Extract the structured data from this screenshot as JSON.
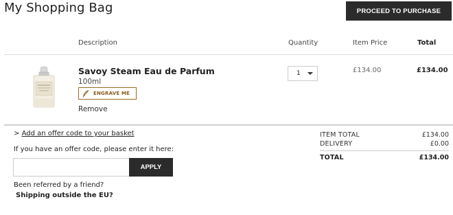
{
  "header": {
    "title": "My Shopping Bag",
    "proceed_label": "PROCEED TO PURCHASE"
  },
  "columns": {
    "description": "Description",
    "quantity": "Quantity",
    "item_price": "Item Price",
    "total": "Total"
  },
  "item": {
    "name": "Savoy Steam Eau de Parfum",
    "size": "100ml",
    "engrave_label": "ENGRAVE ME",
    "remove_label": "Remove",
    "quantity": "1",
    "item_price": "£134.00",
    "total": "£134.00"
  },
  "offer": {
    "prefix": ">",
    "link_label": "Add an offer code to your basket",
    "prompt": "If you have an offer code, please enter it here:",
    "input_value": "",
    "apply_label": "APPLY"
  },
  "footer_links": {
    "referred": "Been referred by a friend?",
    "shipping": "Shipping outside the EU?"
  },
  "summary": {
    "item_total_label": "ITEM TOTAL",
    "item_total_value": "£134.00",
    "delivery_label": "DELIVERY",
    "delivery_value": "£0.00",
    "total_label": "TOTAL",
    "total_value": "£134.00"
  },
  "colors": {
    "dark_button": "#2b2b2b",
    "engrave_accent": "#9a6a20"
  },
  "icons": {
    "engrave": "feather-pen-icon",
    "qty_dropdown": "chevron-down-icon"
  }
}
